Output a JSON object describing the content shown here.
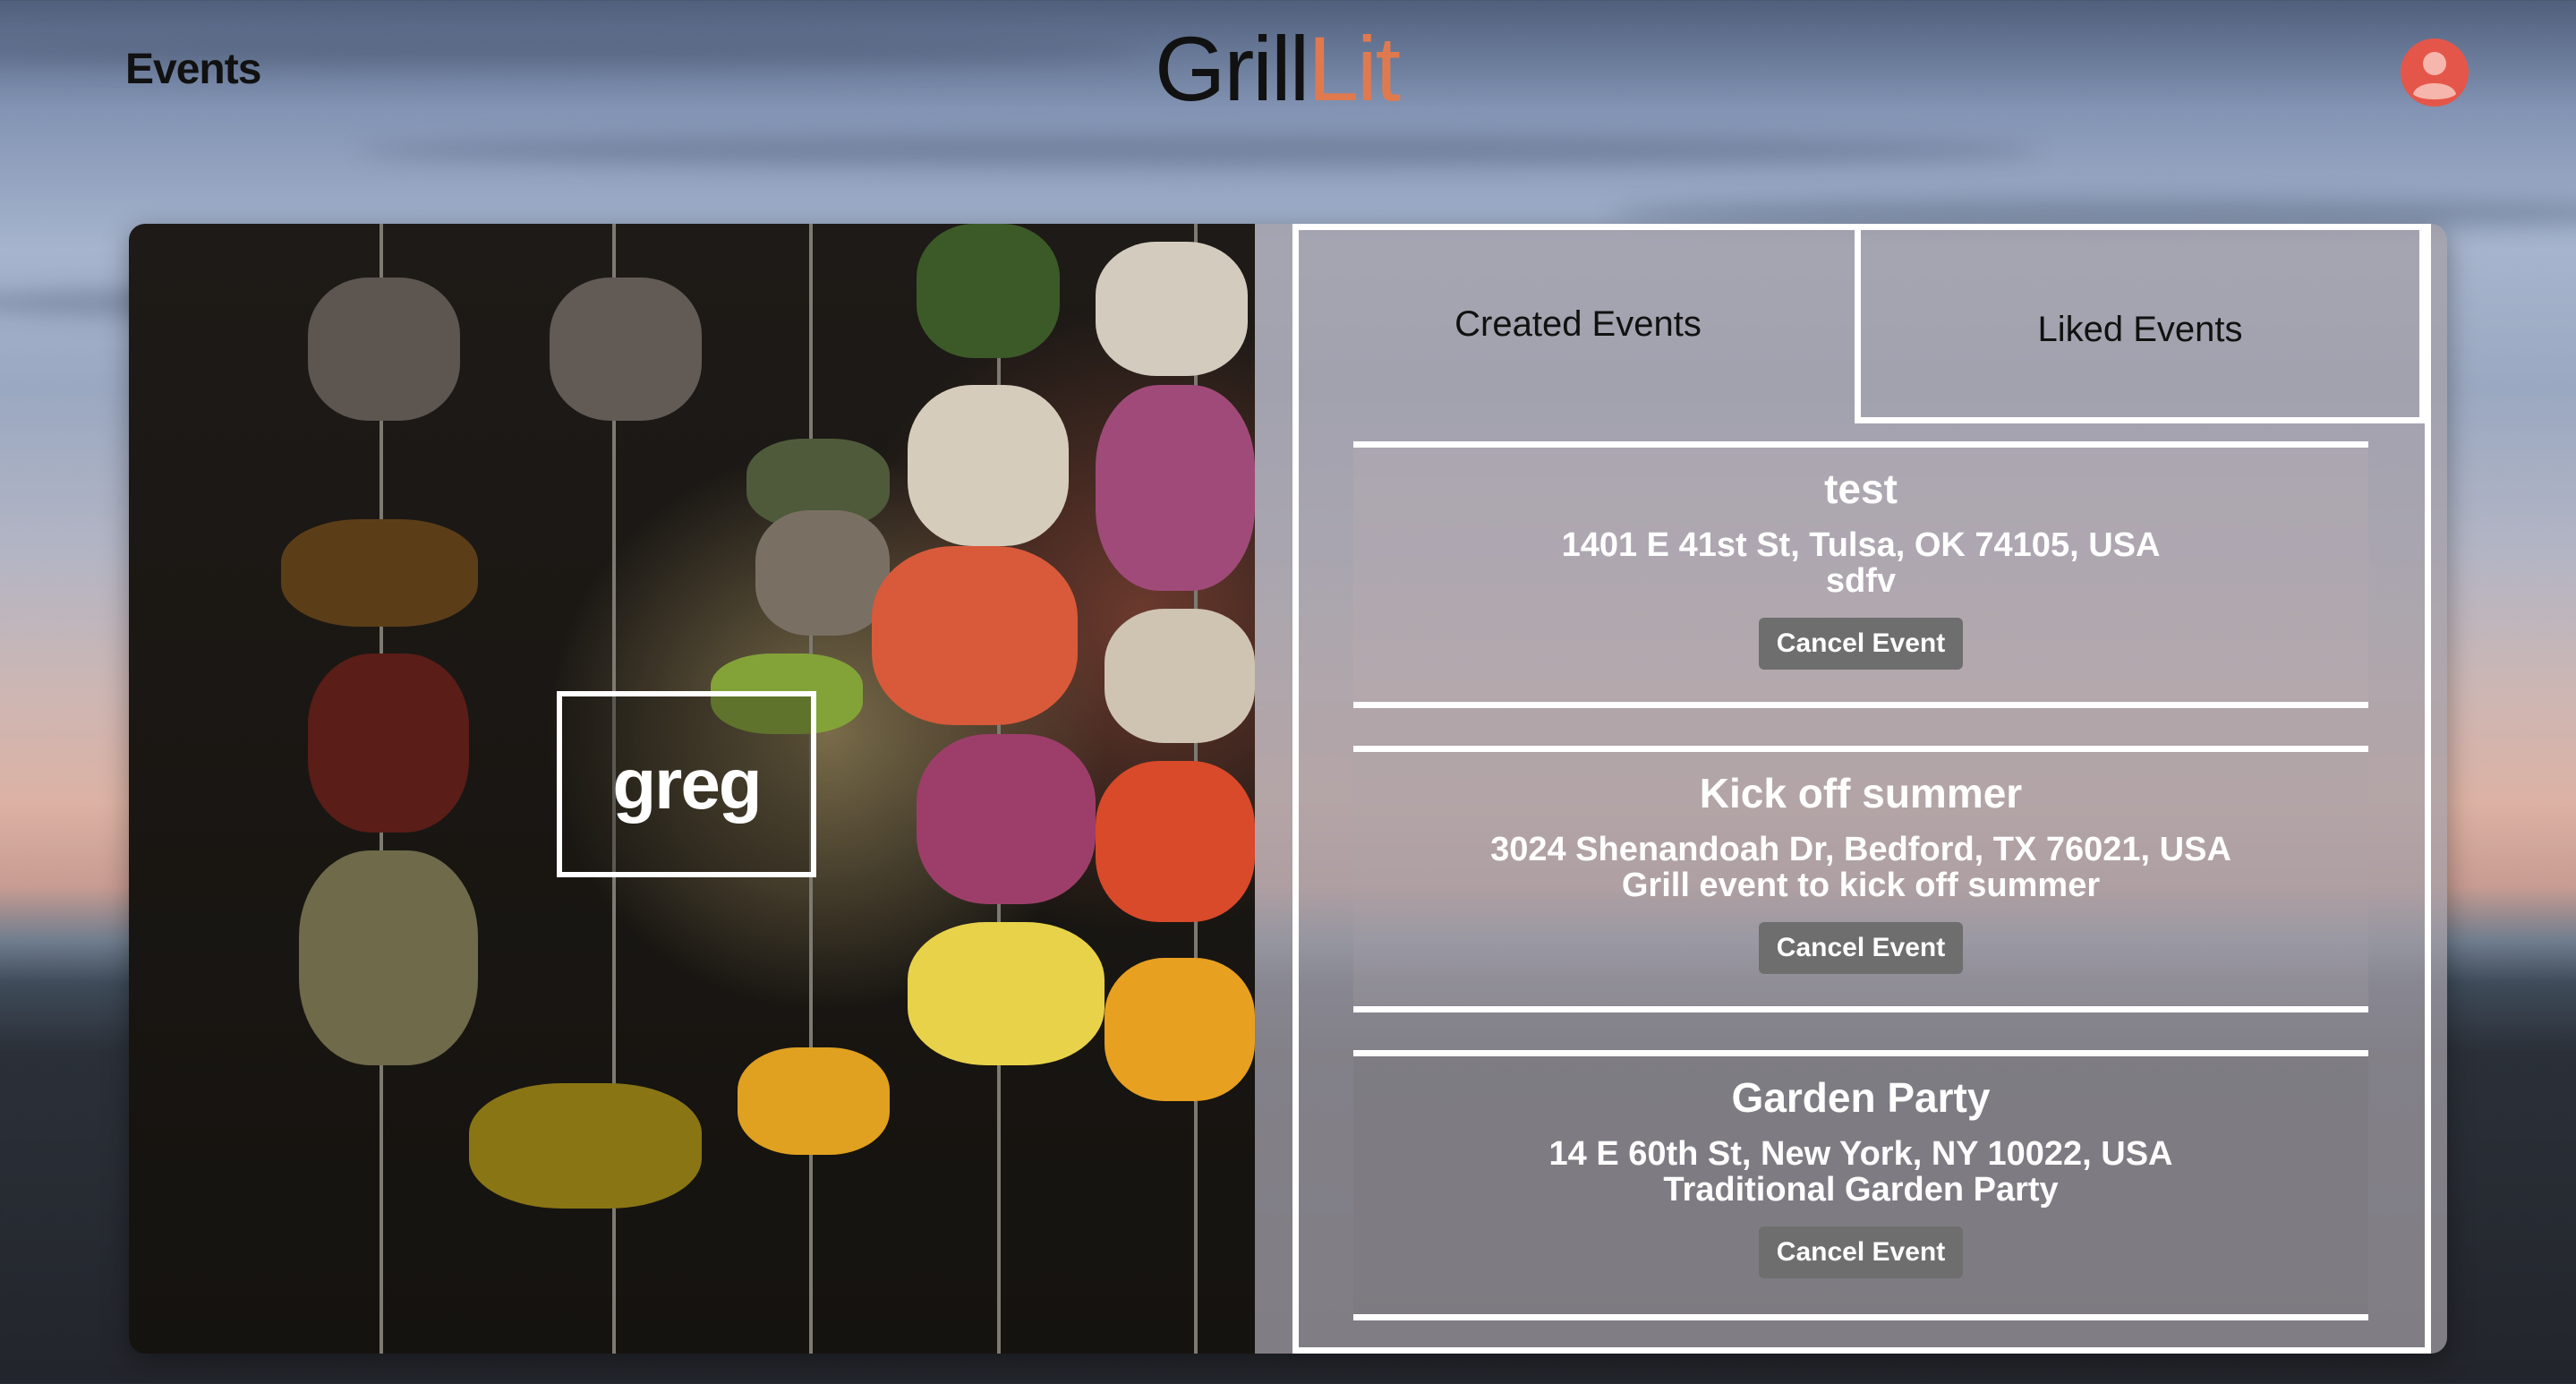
{
  "header": {
    "nav_events": "Events",
    "logo_part1": "Grill",
    "logo_part2": "Lit"
  },
  "profile": {
    "name": "greg"
  },
  "tabs": [
    {
      "label": "Created Events",
      "active": true
    },
    {
      "label": "Liked Events",
      "active": false
    }
  ],
  "events": [
    {
      "title": "test",
      "address": "1401 E 41st St, Tulsa, OK 74105, USA",
      "description": "sdfv",
      "action": "Cancel Event"
    },
    {
      "title": "Kick off summer",
      "address": "3024 Shenandoah Dr, Bedford, TX 76021, USA",
      "description": "Grill event to kick off summer",
      "action": "Cancel Event"
    },
    {
      "title": "Garden Party",
      "address": "14 E 60th St, New York, NY 10022, USA",
      "description": "Traditional Garden Party",
      "action": "Cancel Event"
    }
  ],
  "colors": {
    "logo_accent": "#e07a4e",
    "avatar": "#e5564a",
    "button": "#6e6e6e"
  },
  "icons": {
    "profile": "user-circle-icon"
  }
}
